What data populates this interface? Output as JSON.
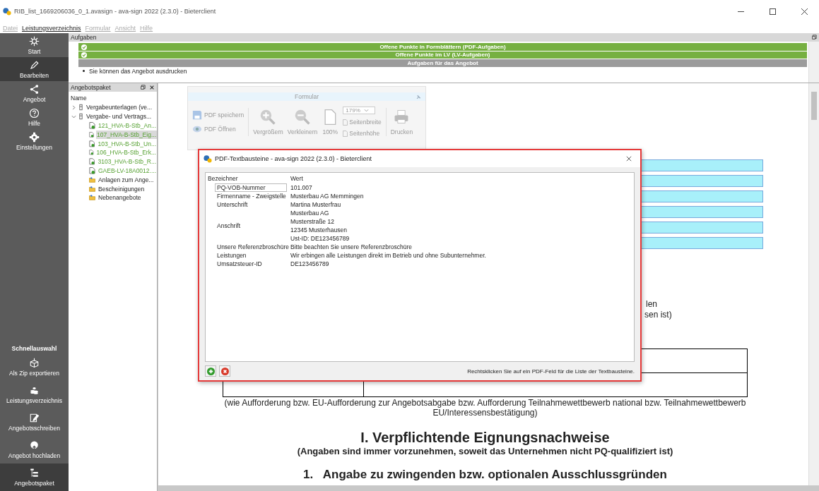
{
  "window": {
    "title": "RIB_list_1669206036_0_1.avasign - ava-sign 2022 (2.3.0) - Bieterclient"
  },
  "menu": [
    {
      "label": "Datei",
      "disabled": true
    },
    {
      "label": "Leistungsverzeichnis",
      "disabled": false
    },
    {
      "label": "Formular",
      "disabled": true
    },
    {
      "label": "Ansicht",
      "disabled": true
    },
    {
      "label": "Hilfe",
      "disabled": true
    }
  ],
  "nav": {
    "items": [
      {
        "label": "Start",
        "selected": false
      },
      {
        "label": "Bearbeiten",
        "selected": true
      },
      {
        "label": "Angebot",
        "selected": false
      },
      {
        "label": "Hilfe",
        "selected": false
      },
      {
        "label": "Einstellungen",
        "selected": false
      }
    ],
    "quick_title": "Schnellauswahl",
    "quick": [
      {
        "label": "Als Zip exportieren",
        "selected": false
      },
      {
        "label": "Leistungsverzeichnis",
        "selected": false
      },
      {
        "label": "Angebotsschreiben",
        "selected": false
      },
      {
        "label": "Angebot hochladen",
        "selected": false
      },
      {
        "label": "Angebotspaket",
        "selected": true
      }
    ]
  },
  "tasks": {
    "title": "Aufgaben",
    "rows": [
      {
        "label": "Offene Punkte in Formblättern (PDF-Aufgaben)",
        "kind": "done"
      },
      {
        "label": "Offene Punkte im LV (LV-Aufgaben)",
        "kind": "done"
      },
      {
        "label": "Aufgaben für das Angebot",
        "kind": "group"
      }
    ],
    "note": "Sie können das Angebot ausdrucken"
  },
  "package": {
    "title": "Angebotspaket",
    "column": "Name",
    "items": [
      {
        "label": "Vergabeunterlagen (ve...",
        "kind": "binder",
        "expanded": false,
        "selected": false
      },
      {
        "label": "Vergabe- und Vertrags...",
        "kind": "binder",
        "expanded": true,
        "selected": false,
        "children": [
          {
            "label": "121_HVA-B-Stb_An...",
            "kind": "file",
            "selected": false
          },
          {
            "label": "107_HVA-B-Stb_Eig...",
            "kind": "file",
            "selected": true
          },
          {
            "label": "103_HVA-B-Stb_Un...",
            "kind": "file",
            "selected": false
          },
          {
            "label": "106_HVA-B-Stb_Erk...",
            "kind": "file",
            "selected": false
          },
          {
            "label": "3103_HVA-B-Stb_R...",
            "kind": "file",
            "selected": false
          },
          {
            "label": "GAEB-LV-18A0012....",
            "kind": "file",
            "selected": false
          },
          {
            "label": "Anlagen zum Ange...",
            "kind": "folder",
            "selected": false
          },
          {
            "label": "Bescheinigungen",
            "kind": "folder",
            "selected": false
          },
          {
            "label": "Nebenangebote",
            "kind": "folder",
            "selected": false
          }
        ]
      }
    ]
  },
  "toolbar": {
    "title": "Formular",
    "save": "PDF speichern",
    "open": "PDF Öffnen",
    "zoom_in": "Vergrößern",
    "zoom_out": "Verkleinern",
    "actual": "100%",
    "zoom_value": "179%",
    "page_width": "Seitenbreite",
    "page_height": "Seitenhöhe",
    "print": "Drucken"
  },
  "document": {
    "side_lines": [
      "len",
      "sen ist)"
    ],
    "note": "(wie Aufforderung bzw. EU-Aufforderung zur Angebotsabgabe bzw. Aufforderung Teilnahmewettbewerb national bzw. Teilnahmewettbewerb EU/Interessensbestätigung)",
    "heading": "I. Verpflichtende Eignungsnachweise",
    "subheading": "(Angaben sind immer vorzunehmen, soweit das Unternehmen nicht PQ-qualifiziert ist)",
    "section": "1.   Angabe zu zwingenden bzw. optionalen Ausschlussgründen"
  },
  "dialog": {
    "title": "PDF-Textbausteine - ava-sign 2022 (2.3.0) - Bieterclient",
    "columns": [
      "Bezeichner",
      "Wert"
    ],
    "rows": [
      {
        "name": "PQ-VOB-Nummer",
        "value": "101.007",
        "selected": true
      },
      {
        "name": "Firmenname - Zweigstelle",
        "value": "Musterbau AG Memmingen",
        "selected": false
      },
      {
        "name": "Unterschrift",
        "value": "Martina Musterfrau",
        "selected": false
      },
      {
        "name": "Anschrift",
        "value": "Musterbau AG\nMusterstraße 12\n12345 Musterhausen\nUst-ID: DE123456789",
        "selected": false
      },
      {
        "name": "Unsere Referenzbroschüre",
        "value": "Bitte beachten Sie unsere  Referenzbroschüre",
        "selected": false
      },
      {
        "name": "Leistungen",
        "value": "Wir erbingen alle Leistungen direkt im Betrieb und ohne Subunternehmer.",
        "selected": false
      },
      {
        "name": "Umsatzsteuer-ID",
        "value": "DE123456789",
        "selected": false
      }
    ],
    "hint": "Rechtsklicken Sie auf ein PDF-Feld für die Liste der Textbausteine."
  }
}
